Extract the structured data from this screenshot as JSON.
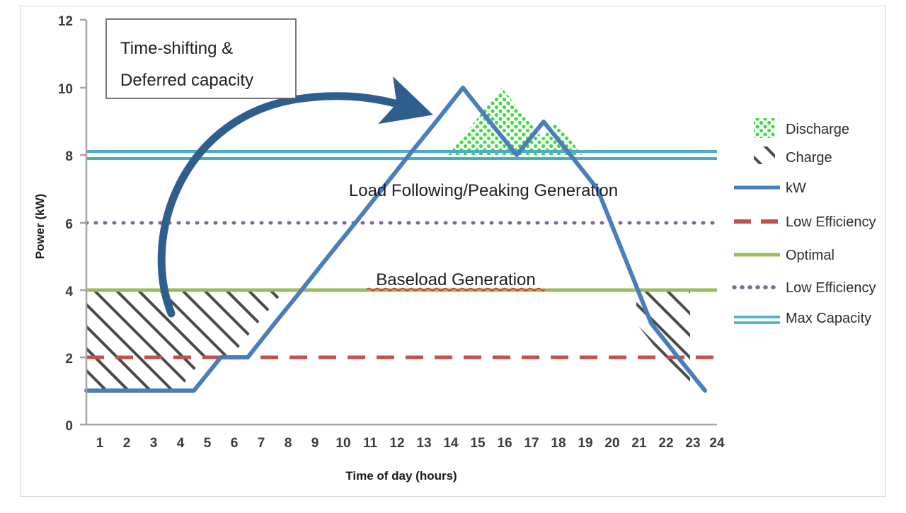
{
  "chart_data": {
    "type": "line",
    "title": "",
    "xlabel": "Time of day (hours)",
    "ylabel": "Power (kW)",
    "xlim": [
      0.5,
      24.5
    ],
    "ylim": [
      0,
      12
    ],
    "yticks": [
      "0",
      "2",
      "4",
      "6",
      "8",
      "10",
      "12"
    ],
    "xticks": [
      "1",
      "2",
      "3",
      "4",
      "5",
      "6",
      "7",
      "8",
      "9",
      "10",
      "11",
      "12",
      "13",
      "14",
      "15",
      "16",
      "17",
      "18",
      "19",
      "20",
      "21",
      "22",
      "23",
      "24"
    ],
    "grid": false,
    "legend_position": "right",
    "x": [
      1,
      2,
      3,
      4,
      5,
      6,
      7,
      8,
      9,
      10,
      11,
      12,
      13,
      14,
      15,
      16,
      17,
      18,
      19,
      20,
      21,
      22,
      23,
      24
    ],
    "series": [
      {
        "name": "kW",
        "type": "line",
        "color": "#4A7EBB",
        "style": "solid",
        "values": [
          1,
          1,
          1,
          1,
          1,
          2,
          2,
          3,
          4,
          5,
          6,
          7,
          8,
          9,
          10,
          9,
          8,
          9,
          8,
          7,
          5,
          3,
          2,
          1
        ]
      },
      {
        "name": "Low Efficiency",
        "type": "hline",
        "color": "#C0504D",
        "style": "dashed",
        "value": 2
      },
      {
        "name": "Optimal",
        "type": "hline",
        "color": "#9BBB59",
        "style": "solid",
        "value": 4
      },
      {
        "name": "Low Efficiency",
        "type": "hline",
        "color": "#8064A2",
        "style": "dotted",
        "value": 6
      },
      {
        "name": "Max Capacity",
        "type": "hline-double",
        "color": "#4BACC6",
        "style": "double",
        "value": 8,
        "value_upper": 8.1,
        "value_lower": 7.9
      }
    ],
    "regions": [
      {
        "name": "Discharge",
        "pattern": "dots",
        "color": "#33DD33",
        "description": "Area where kW exceeds Max Capacity (8 kW), hours 13-19"
      },
      {
        "name": "Charge",
        "pattern": "diagonal-hatch",
        "color": "#555555",
        "description": "Area between kW curve and Optimal line (4 kW), hours 1-9 and 21.5-24"
      }
    ],
    "annotations": [
      {
        "text": "Load Following/Peaking Generation",
        "x": 13,
        "y": 5.7
      },
      {
        "text": "Baseload Generation",
        "x": 12,
        "y": 4.3,
        "spellcheck_underline": true
      }
    ]
  },
  "callout_box": {
    "line1": "Time-shifting &",
    "line2": "Deferred capacity",
    "border_color": "#595959",
    "arrow_color": "#2E5E8E"
  },
  "axes": {
    "y_title": "Power (kW)",
    "x_title": "Time of day (hours)",
    "y_ticks": [
      "12",
      "10",
      "8",
      "6",
      "4",
      "2",
      "0"
    ],
    "x_ticks": [
      "1",
      "2",
      "3",
      "4",
      "5",
      "6",
      "7",
      "8",
      "9",
      "10",
      "11",
      "12",
      "13",
      "14",
      "15",
      "16",
      "17",
      "18",
      "19",
      "20",
      "21",
      "22",
      "23",
      "24"
    ]
  },
  "legend": {
    "items": [
      {
        "label": "Discharge",
        "marker": "dot-pattern-swatch",
        "color": "#33DD33"
      },
      {
        "label": "Charge",
        "marker": "hatch-pattern-swatch",
        "color": "#555555"
      },
      {
        "label": "kW",
        "marker": "solid-line",
        "color": "#4A7EBB"
      },
      {
        "label": "Low Efficiency",
        "marker": "dashed-line",
        "color": "#C0504D"
      },
      {
        "label": "Optimal",
        "marker": "solid-line",
        "color": "#9BBB59"
      },
      {
        "label": "Low Efficiency",
        "marker": "dotted-line",
        "color": "#8064A2"
      },
      {
        "label": "Max Capacity",
        "marker": "double-line",
        "color": "#4BACC6"
      }
    ]
  }
}
